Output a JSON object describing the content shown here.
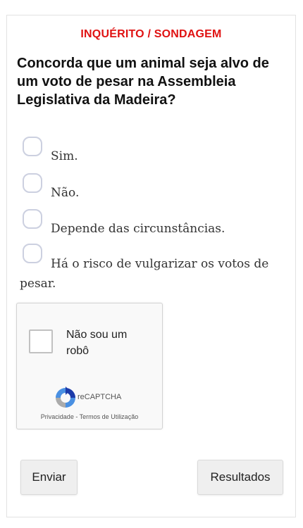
{
  "poll": {
    "header": "INQUÉRITO / SONDAGEM",
    "question": "Concorda que um animal seja alvo de um voto de pesar na Assembleia Legislativa da Madeira?",
    "options": [
      {
        "label": "Sim."
      },
      {
        "label": "Não."
      },
      {
        "label": "Depende das circunstâncias."
      },
      {
        "label": "Há o risco de vulgarizar os votos de pesar."
      }
    ]
  },
  "captcha": {
    "checkbox_label": "Não sou um robô",
    "brand": "reCAPTCHA",
    "privacy_link": "Privacidade",
    "separator": " - ",
    "terms_link": "Termos de Utilização",
    "icon": "recaptcha-logo-icon"
  },
  "buttons": {
    "send_label": "Enviar",
    "results_label": "Resultados"
  },
  "colors": {
    "header": "#e01212",
    "radio_border": "#ccd0e0",
    "button_bg": "#efefef"
  }
}
